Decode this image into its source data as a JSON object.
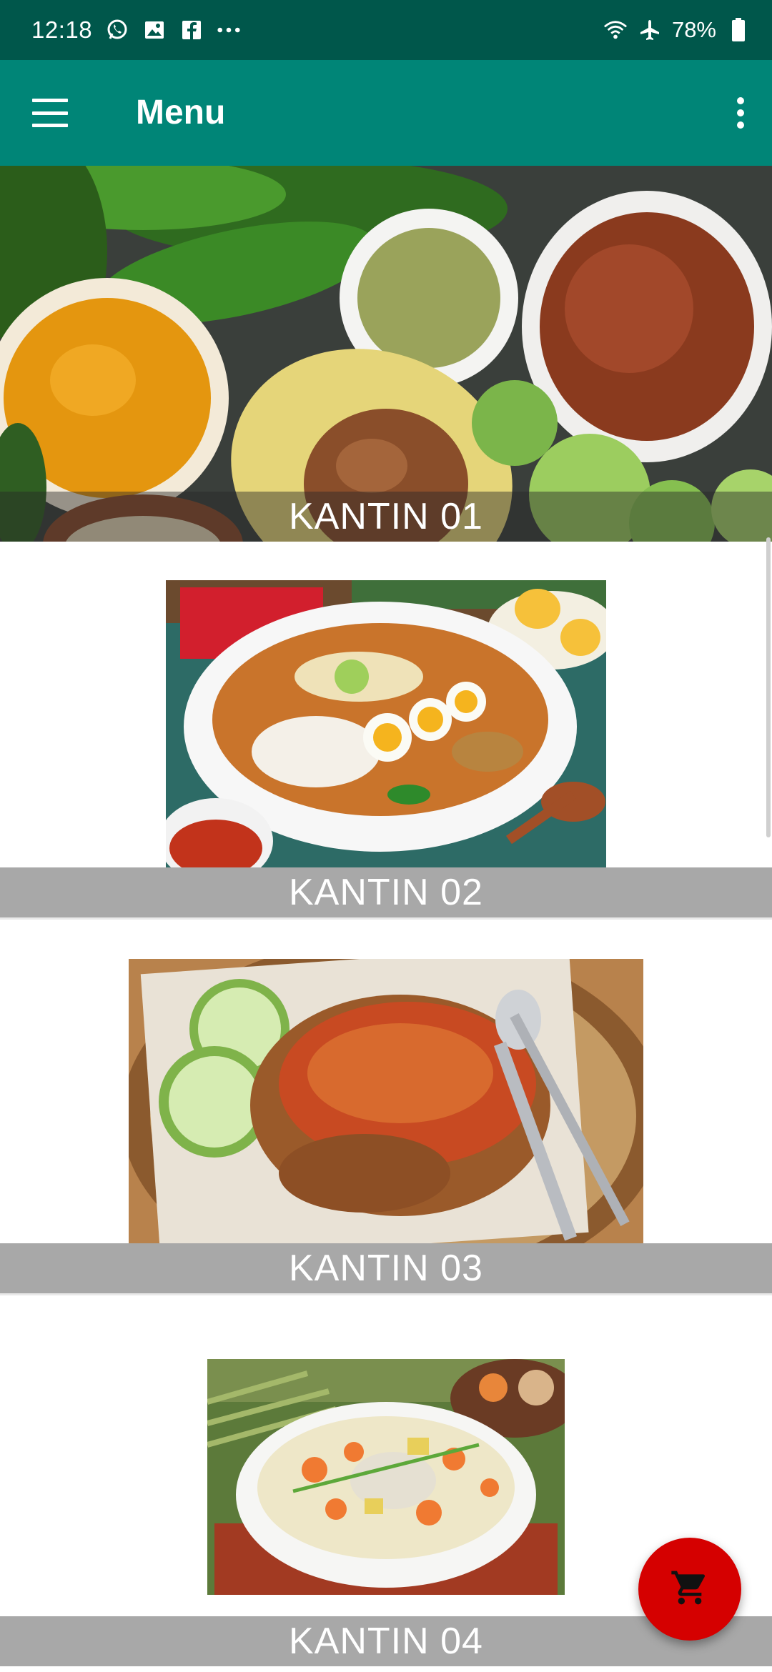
{
  "status_bar": {
    "time": "12:18",
    "notification_icons": [
      "whatsapp-icon",
      "gallery-icon",
      "facebook-icon",
      "more-dots-icon"
    ],
    "right_icons": [
      "wifi-icon",
      "airplane-icon"
    ],
    "battery_percent": "78%"
  },
  "app_bar": {
    "title": "Menu",
    "nav_icon": "hamburger-menu-icon",
    "overflow_icon": "more-vert-icon",
    "color": "#008577",
    "status_color": "#00574b"
  },
  "canteens": [
    {
      "label": "KANTIN 01",
      "image": "healthy-ingredients-photo"
    },
    {
      "label": "KANTIN 02",
      "image": "soto-noodle-soup-photo"
    },
    {
      "label": "KANTIN 03",
      "image": "ayam-penyet-sambal-photo"
    },
    {
      "label": "KANTIN 04",
      "image": "vegetable-soup-photo"
    }
  ],
  "fab": {
    "icon": "shopping-cart-icon",
    "color": "#d50000"
  }
}
